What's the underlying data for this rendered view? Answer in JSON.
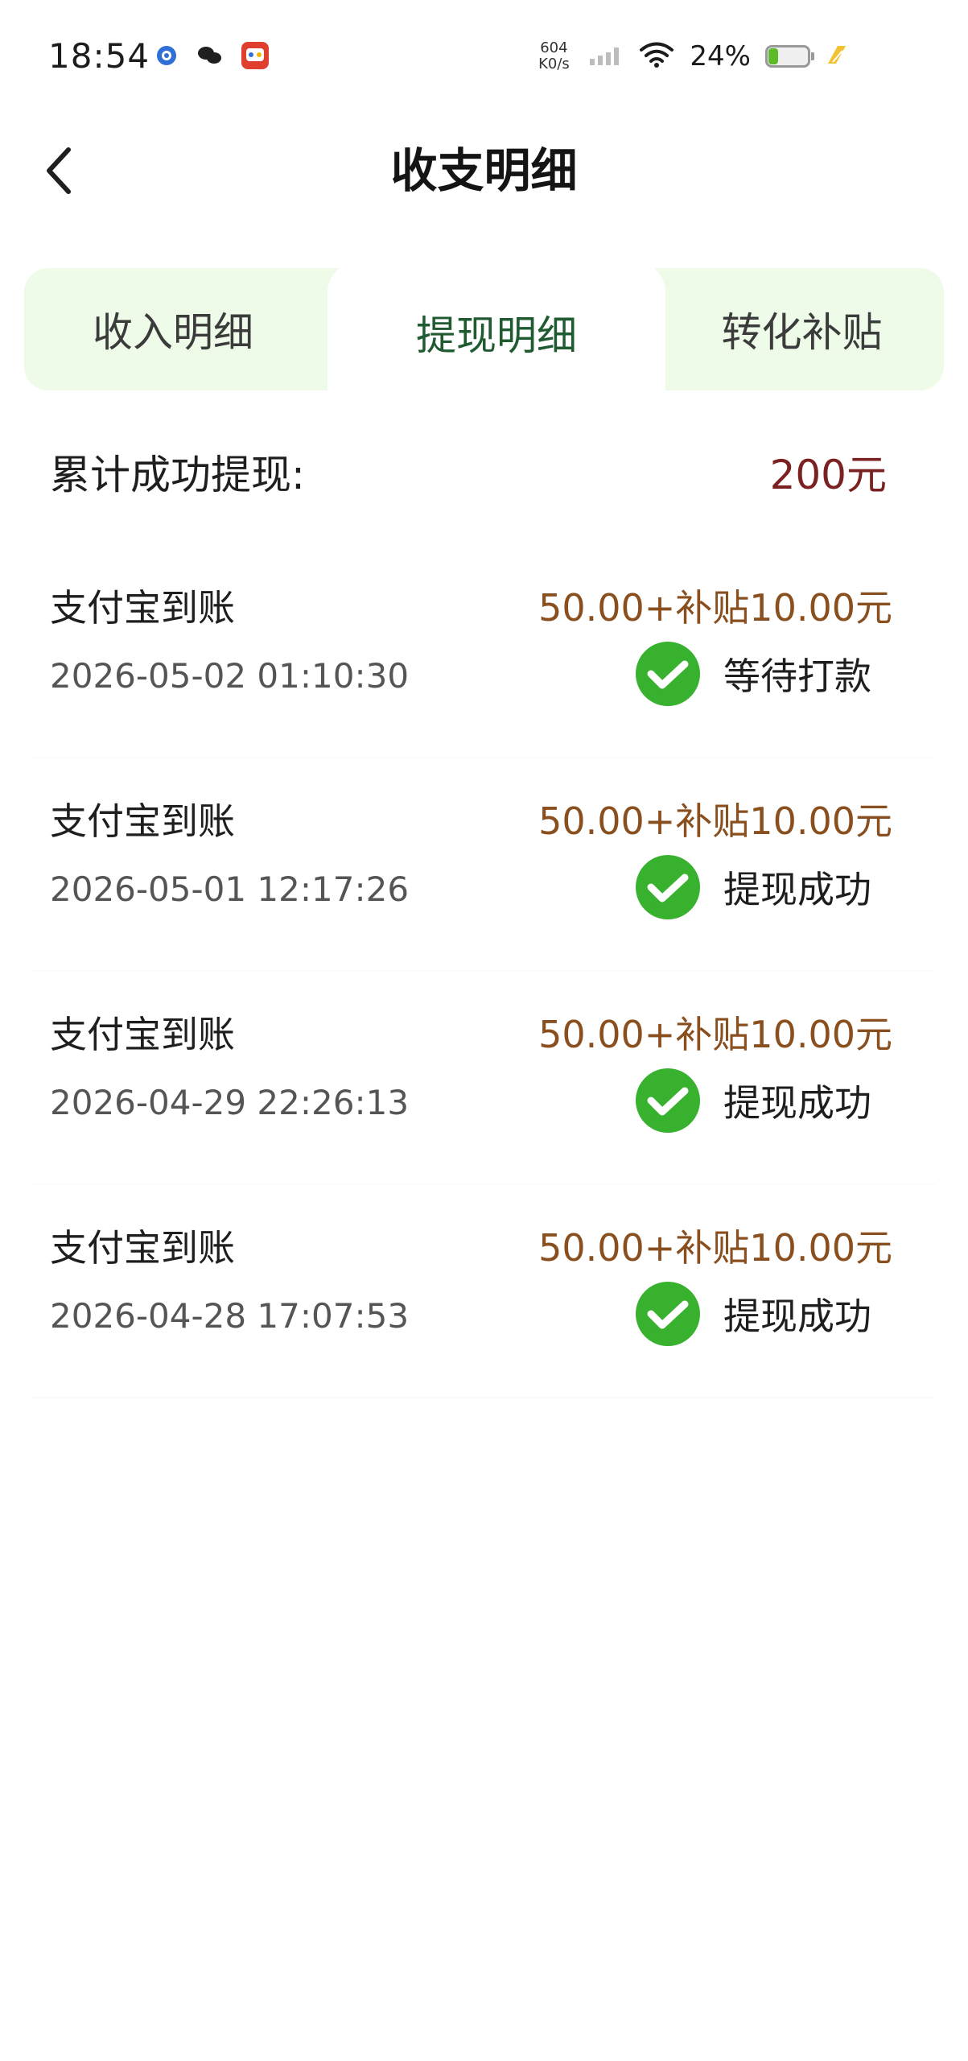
{
  "status_bar": {
    "time": "18:54",
    "net_speed_top": "604",
    "net_speed_bottom": "K0/s",
    "battery": "24%",
    "battery_level": 0.24,
    "app_icons": [
      "app-icon-1",
      "app-icon-2",
      "app-icon-3"
    ]
  },
  "header": {
    "title": "收支明细"
  },
  "tabs": [
    {
      "label": "收入明细",
      "active": false
    },
    {
      "label": "提现明细",
      "active": true
    },
    {
      "label": "转化补贴",
      "active": false
    }
  ],
  "summary": {
    "label": "累计成功提现:",
    "value": "200元"
  },
  "records": [
    {
      "title": "支付宝到账",
      "time": "2026-05-02 01:10:30",
      "amount": "50.00+补贴10.00元",
      "status": "等待打款"
    },
    {
      "title": "支付宝到账",
      "time": "2026-05-01 12:17:26",
      "amount": "50.00+补贴10.00元",
      "status": "提现成功"
    },
    {
      "title": "支付宝到账",
      "time": "2026-04-29 22:26:13",
      "amount": "50.00+补贴10.00元",
      "status": "提现成功"
    },
    {
      "title": "支付宝到账",
      "time": "2026-04-28 17:07:53",
      "amount": "50.00+补贴10.00元",
      "status": "提现成功"
    }
  ],
  "colors": {
    "accent_green": "#1f5a31",
    "tab_bg": "#eefbe8",
    "amount": "#8a4f1f",
    "summary_value": "#7a2221",
    "wechat_green": "#38b12f"
  }
}
